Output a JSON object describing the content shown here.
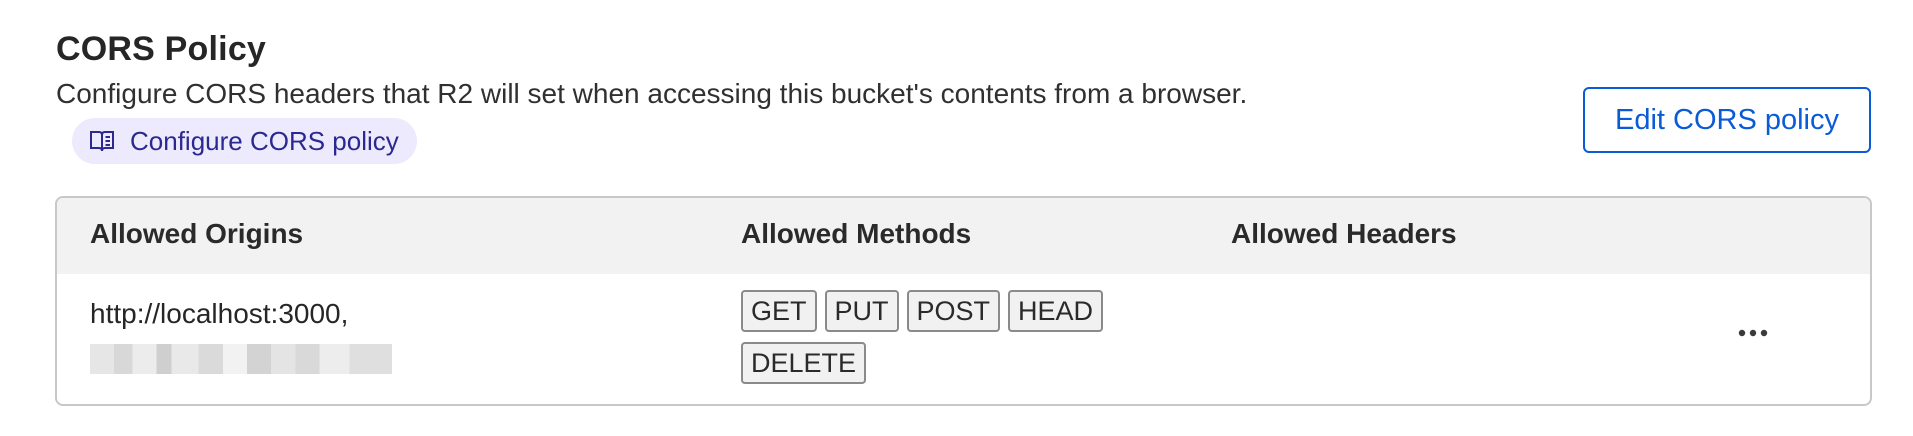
{
  "section": {
    "title": "CORS Policy",
    "description": "Configure CORS headers that R2 will set when accessing this bucket's contents from a browser.",
    "doc_link_label": "Configure CORS policy",
    "doc_link_icon": "book-icon",
    "edit_button_label": "Edit CORS policy"
  },
  "table": {
    "headers": [
      "Allowed Origins",
      "Allowed Methods",
      "Allowed Headers"
    ],
    "rows": [
      {
        "origins": [
          "http://localhost:3000,"
        ],
        "origins_redacted": true,
        "methods": [
          "GET",
          "PUT",
          "POST",
          "HEAD",
          "DELETE"
        ],
        "headers": [],
        "actions_icon": "more-horizontal-icon"
      }
    ]
  },
  "colors": {
    "accent": "#0a5bd6",
    "doc_link_bg": "#eceafc",
    "doc_link_text": "#2b2890",
    "table_header_bg": "#f2f2f2",
    "table_border": "#c8c8c8"
  }
}
